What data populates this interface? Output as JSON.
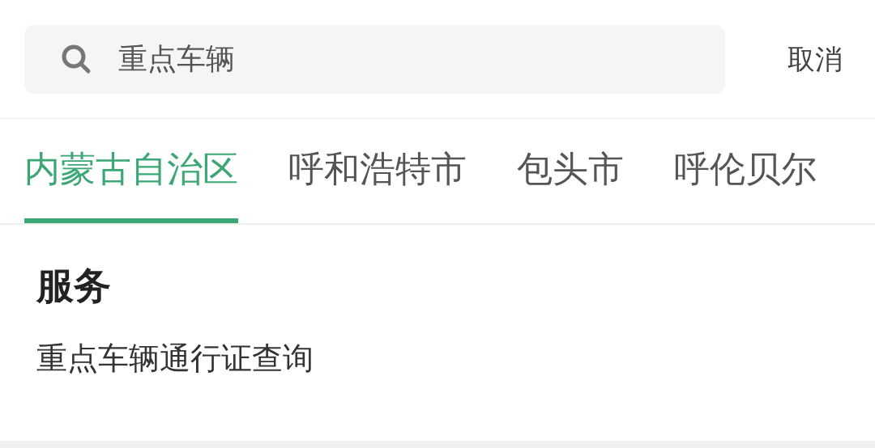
{
  "search": {
    "value": "重点车辆"
  },
  "cancel": "取消",
  "tabs": [
    {
      "label": "内蒙古自治区",
      "selected": true
    },
    {
      "label": "呼和浩特市",
      "selected": false
    },
    {
      "label": "包头市",
      "selected": false
    },
    {
      "label": "呼伦贝尔",
      "selected": false
    }
  ],
  "section": {
    "title": "服务",
    "items": [
      "重点车辆通行证查询"
    ]
  }
}
